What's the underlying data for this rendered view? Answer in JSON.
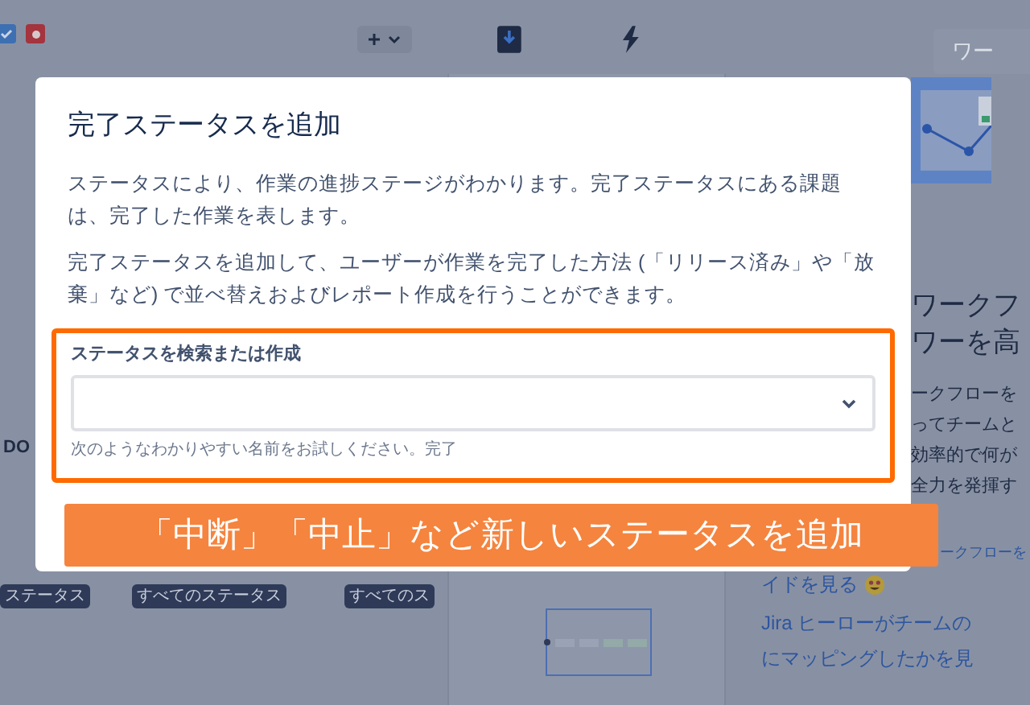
{
  "toolbar": {
    "search_placeholder": "ワー"
  },
  "board": {
    "column_label": "DO",
    "badges": [
      "ステータス",
      "すべてのステータス",
      "すべてのス"
    ]
  },
  "side_panel": {
    "heading_lines": [
      "ワークフ",
      "ワーを高"
    ],
    "body_lines": [
      "ークフローを",
      "ってチームと",
      "効率的で何が",
      "全力を発揮す"
    ],
    "link_lines": [
      "ークフローを",
      "イドを見る",
      "Jira ヒーローがチームの",
      "にマッピングしたかを見"
    ]
  },
  "dialog": {
    "title": "完了ステータスを追加",
    "paragraphs": [
      "ステータスにより、作業の進捗ステージがわかります。完了ステータスにある課題は、完了した作業を表します。",
      "完了ステータスを追加して、ユーザーが作業を完了した方法 (「リリース済み」や「放棄」など) で並べ替えおよびレポート作成を行うことができます。"
    ],
    "field": {
      "label": "ステータスを検索または作成",
      "helper": "次のようなわかりやすい名前をお試しください。完了",
      "highlighted": true
    }
  },
  "caption": "「中断」「中止」など新しいステータスを追加"
}
